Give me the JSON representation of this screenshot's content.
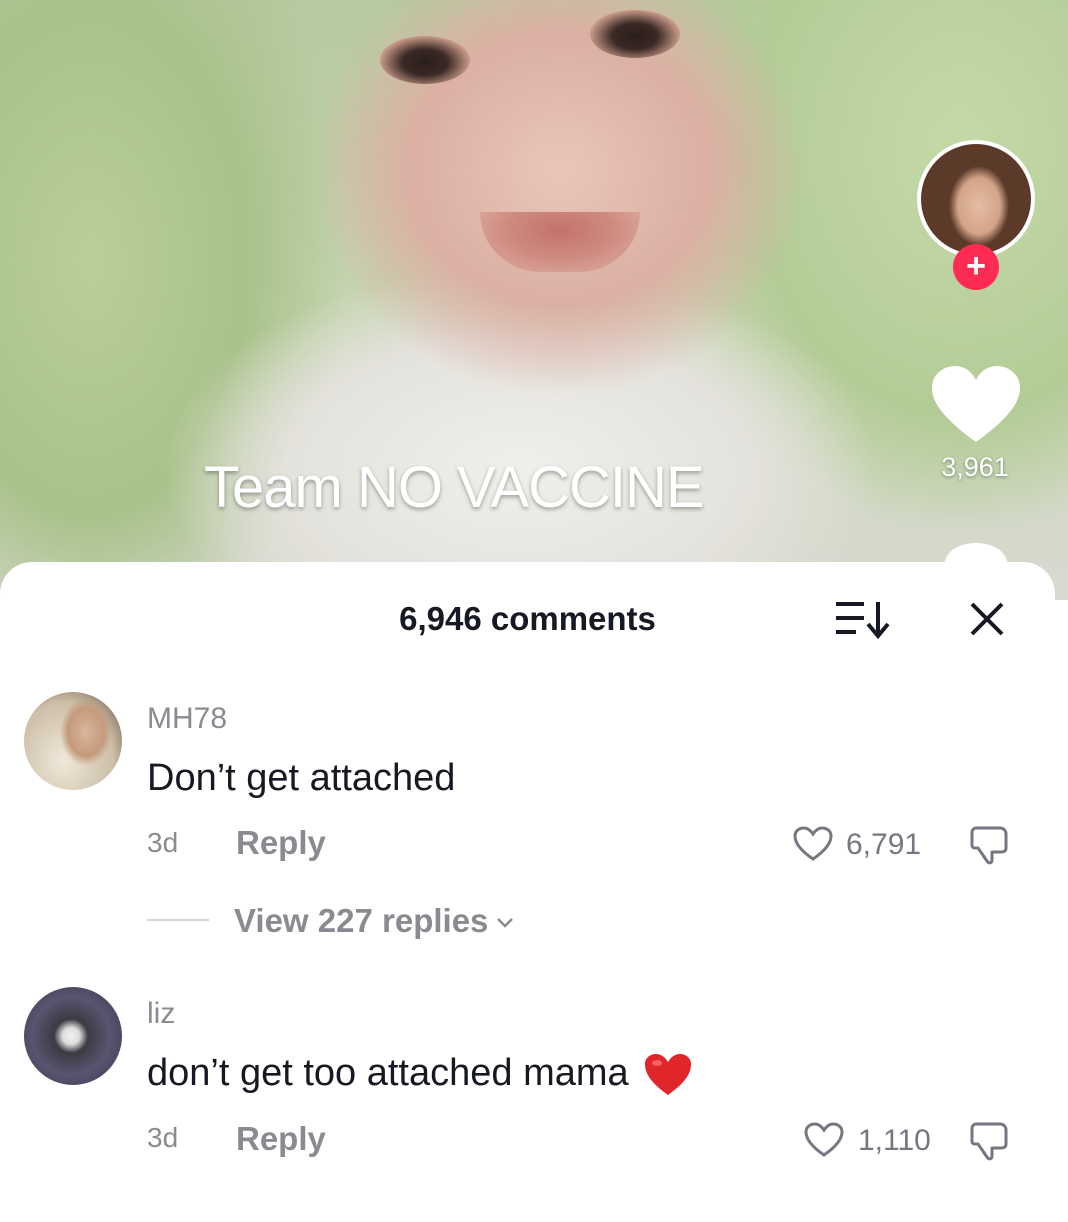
{
  "video": {
    "caption": "Team NO VACCINE",
    "like_count": "3,961",
    "follow_symbol": "+"
  },
  "comments_panel": {
    "title": "6,946 comments",
    "sort_icon": "sort-arrow-down-icon",
    "close_icon": "close-icon"
  },
  "comments": [
    {
      "username": "MH78",
      "text": "Don’t get attached",
      "time": "3d",
      "reply_label": "Reply",
      "likes": "6,791",
      "view_replies": "View 227 replies"
    },
    {
      "username": "liz",
      "text": "don’t get too attached mama",
      "emoji": "red-heart",
      "time": "3d",
      "reply_label": "Reply",
      "likes": "1,110"
    }
  ],
  "colors": {
    "follow_plus": "#fe2c55",
    "heart_emoji": "#e0262b",
    "muted_text": "#8a8b91",
    "primary_text": "#161823"
  }
}
